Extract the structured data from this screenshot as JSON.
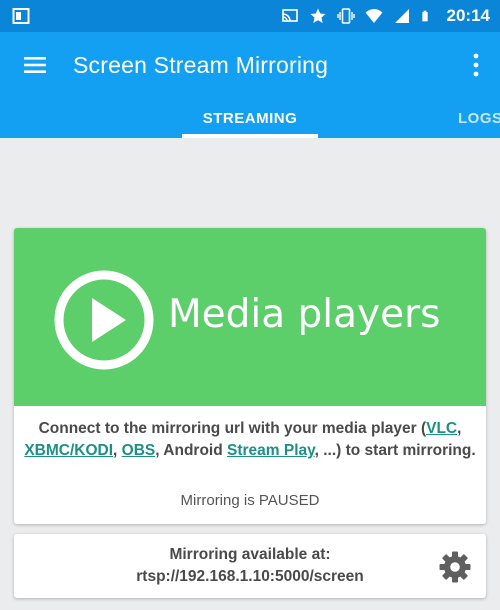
{
  "status_bar": {
    "time": "20:14",
    "icons": [
      "cast-icon",
      "star-icon",
      "vibrate-icon",
      "wifi-icon",
      "signal-icon",
      "battery-icon"
    ]
  },
  "app_bar": {
    "title": "Screen Stream Mirroring",
    "tabs": [
      {
        "label": "STREAMING",
        "selected": true
      },
      {
        "label": "LOGS",
        "selected": false
      }
    ]
  },
  "media_card": {
    "banner_text": "Media players",
    "connect_prefix": "Connect to the mirroring url with your media player (",
    "links": [
      "VLC",
      "XBMC/KODI",
      "OBS",
      "Stream Play"
    ],
    "sep_comma": ", ",
    "android_text": ", Android ",
    "connect_suffix": ", ...) to start mirroring.",
    "status": "Mirroring is PAUSED"
  },
  "address_card": {
    "label": "Mirroring available at:",
    "url": "rtsp://192.168.1.10:5000/screen"
  },
  "colors": {
    "status_bar": "#0a85d8",
    "app_bar": "#14a0f2",
    "banner": "#5ccf6a",
    "link": "#1d8f86"
  }
}
